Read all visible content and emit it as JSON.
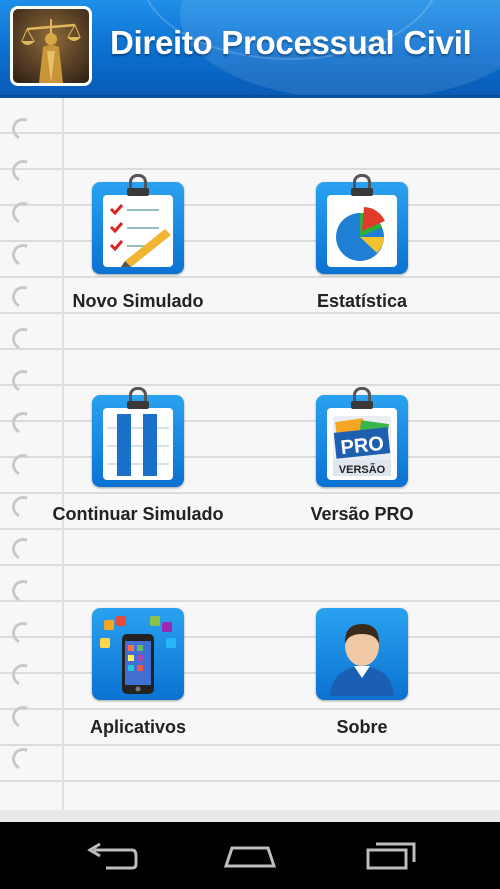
{
  "header": {
    "title": "Direito Processual Civil",
    "logo_icon": "justice-statue-icon"
  },
  "menu": {
    "items": [
      {
        "label": "Novo Simulado",
        "icon": "checklist-pencil-icon"
      },
      {
        "label": "Estatística",
        "icon": "pie-chart-icon"
      },
      {
        "label": "Continuar Simulado",
        "icon": "pause-icon"
      },
      {
        "label": "Versão PRO",
        "icon": "pro-version-icon",
        "badge_top": "PRO",
        "badge_bottom": "VERSÃO"
      },
      {
        "label": "Aplicativos",
        "icon": "smartphone-apps-icon"
      },
      {
        "label": "Sobre",
        "icon": "user-avatar-icon"
      }
    ]
  },
  "navbar": {
    "back_icon": "back-icon",
    "home_icon": "home-icon",
    "recents_icon": "recents-icon"
  },
  "colors": {
    "header_blue": "#0b6fd0",
    "tile_blue": "#1a8ae6",
    "paper": "#f7f7f7"
  }
}
